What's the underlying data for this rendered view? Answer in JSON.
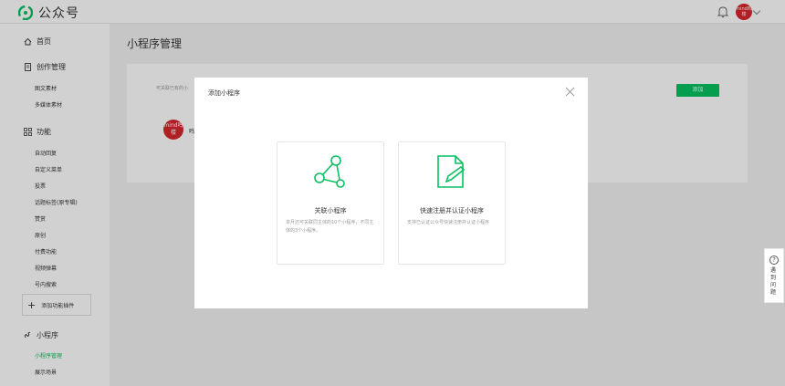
{
  "header": {
    "brand_name": "公众号",
    "avatar_text": "mind鸣楼"
  },
  "sidebar": {
    "home": "首页",
    "creation": "创作管理",
    "creation_items": [
      "图文素材",
      "多媒体素材"
    ],
    "features": "功能",
    "feature_items": [
      "自动回复",
      "自定义菜单",
      "投票",
      "话题标签(原专辑)",
      "赞赏",
      "原创",
      "付费功能",
      "视频弹幕",
      "号内搜索"
    ],
    "add_plugin": "添加功能插件",
    "miniprogram": "小程序",
    "miniprogram_items": [
      "小程序管理",
      "展示场景"
    ]
  },
  "main": {
    "title": "小程序管理",
    "desc": "可关联已有的小",
    "add_button": "添加",
    "avatar_text": "mind鸣楼",
    "list_name": "鸣"
  },
  "modal": {
    "title": "添加小程序",
    "options": [
      {
        "title": "关联小程序",
        "desc": "本月还可关联同主体的10个小程序，不同主体的3个小程序。",
        "icon": "link-nodes-icon"
      },
      {
        "title": "快速注册并认证小程序",
        "desc": "支持已认证公众号快速注册并认证小程序",
        "icon": "document-edit-icon"
      }
    ]
  },
  "float": {
    "help_text": "遇到问题"
  },
  "colors": {
    "accent": "#07c160",
    "avatar": "#d6262d"
  }
}
